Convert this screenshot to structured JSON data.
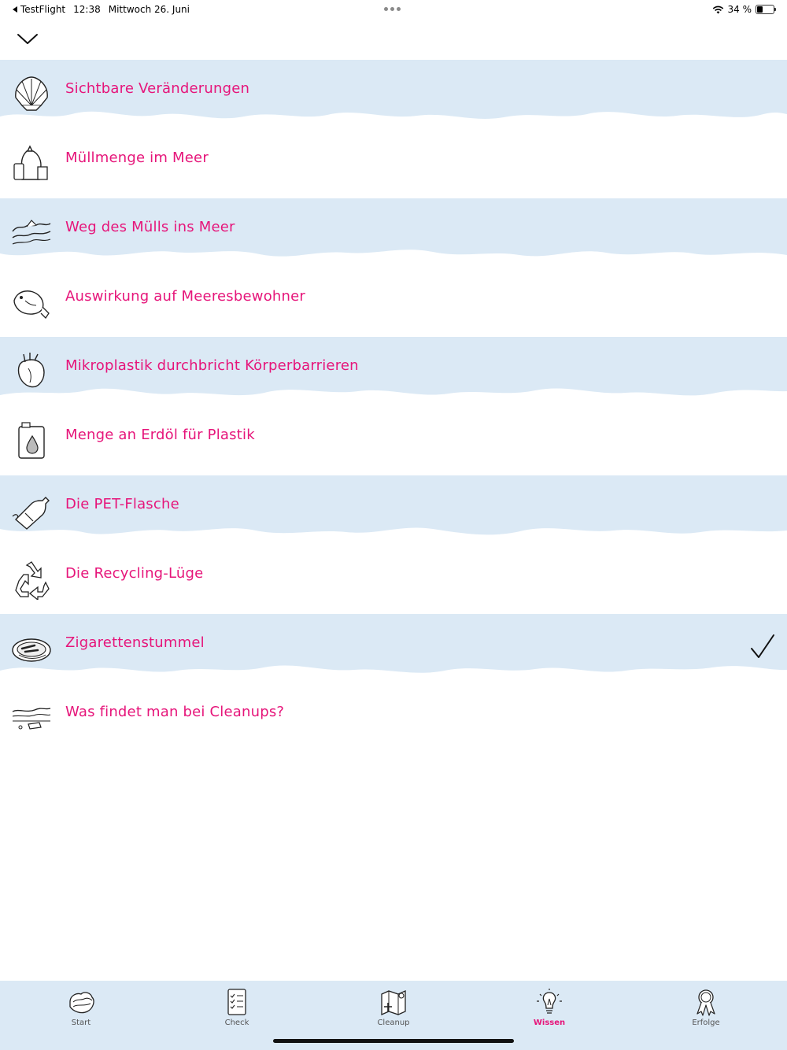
{
  "status_bar": {
    "back_app": "TestFlight",
    "time": "12:38",
    "date": "Mittwoch 26. Juni",
    "battery": "34 %"
  },
  "topics": [
    {
      "label": "Sichtbare Veränderungen",
      "icon": "shell-icon",
      "checked": false
    },
    {
      "label": "Müllmenge im Meer",
      "icon": "trash-bag-icon",
      "checked": false
    },
    {
      "label": "Weg des Mülls ins Meer",
      "icon": "waves-icon",
      "checked": false
    },
    {
      "label": "Auswirkung auf Meeresbewohner",
      "icon": "fish-icon",
      "checked": false
    },
    {
      "label": "Mikroplastik durchbricht Körperbarrieren",
      "icon": "heart-icon",
      "checked": false
    },
    {
      "label": "Menge an Erdöl für Plastik",
      "icon": "oil-canister-icon",
      "checked": false
    },
    {
      "label": "Die PET-Flasche",
      "icon": "bottle-icon",
      "checked": false
    },
    {
      "label": "Die Recycling-Lüge",
      "icon": "recycling-icon",
      "checked": false
    },
    {
      "label": "Zigarettenstummel",
      "icon": "ashtray-icon",
      "checked": true
    },
    {
      "label": "Was findet man bei Cleanups?",
      "icon": "beach-debris-icon",
      "checked": false
    }
  ],
  "tabs": [
    {
      "label": "Start",
      "icon": "start-icon",
      "active": false
    },
    {
      "label": "Check",
      "icon": "checklist-icon",
      "active": false
    },
    {
      "label": "Cleanup",
      "icon": "map-icon",
      "active": false
    },
    {
      "label": "Wissen",
      "icon": "lightbulb-icon",
      "active": true
    },
    {
      "label": "Erfolge",
      "icon": "award-icon",
      "active": false
    }
  ],
  "colors": {
    "accent": "#e6157a",
    "tint": "#dbe9f5"
  }
}
